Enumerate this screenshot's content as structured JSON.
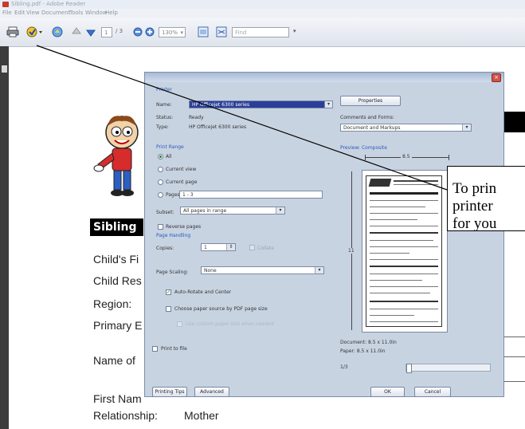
{
  "app": {
    "title": "Sibling.pdf - Adobe Reader"
  },
  "menu": [
    "File",
    "Edit",
    "View",
    "Document",
    "Tools",
    "Window",
    "Help"
  ],
  "toolbar": {
    "page_current": "1",
    "page_total": "/ 3",
    "zoom": "130%",
    "find_placeholder": "Find"
  },
  "document": {
    "section_title": "Sibling",
    "fields": [
      "Child's Fi",
      "Child Res",
      "Region:",
      "Primary E",
      "Name of",
      "First Nam",
      "Relationship:"
    ],
    "relationship_value": "Mother"
  },
  "dialog": {
    "printer_section": "Printer",
    "name_label": "Name:",
    "printer_name": "HP Officejet 6300 series",
    "status_label": "Status:",
    "status_value": "Ready",
    "type_label": "Type:",
    "type_value": "HP Officejet 6300 series",
    "properties_button": "Properties",
    "comments_label": "Comments and Forms:",
    "comments_value": "Document and Markups",
    "print_range_section": "Print Range",
    "range_all": "All",
    "range_current_view": "Current view",
    "range_current_page": "Current page",
    "range_pages": "Pages",
    "pages_value": "1 - 3",
    "subset_label": "Subset:",
    "subset_value": "All pages in range",
    "reverse_pages": "Reverse pages",
    "page_handling_section": "Page Handling",
    "copies_label": "Copies:",
    "copies_value": "1",
    "collate_label": "Collate",
    "scaling_label": "Page Scaling:",
    "scaling_value": "None",
    "auto_rotate": "Auto-Rotate and Center",
    "choose_paper": "Choose paper source by PDF page size",
    "custom_paper": "Use custom paper size when needed",
    "print_to_file": "Print to file",
    "preview_label": "Preview: Composite",
    "preview_width": "8.5",
    "preview_height": "11",
    "document_size": "Document: 8.5 x 11.0in",
    "paper_size": "Paper: 8.5 x 11.0in",
    "page_counter": "1/3",
    "printing_tips_button": "Printing Tips",
    "advanced_button": "Advanced",
    "ok_button": "OK",
    "cancel_button": "Cancel"
  },
  "callout": {
    "line1": "To prin",
    "line2": "printer",
    "line3": "for you"
  }
}
